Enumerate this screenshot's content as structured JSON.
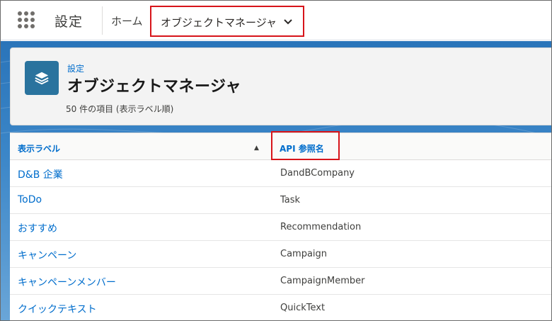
{
  "nav": {
    "app_name": "設定",
    "home": "ホーム",
    "active_tab": "オブジェクトマネージャ"
  },
  "header": {
    "breadcrumb": "設定",
    "title": "オブジェクトマネージャ",
    "count": "50 件の項目 (表示ラベル順)"
  },
  "table": {
    "columns": [
      "表示ラベル",
      "API 参照名"
    ],
    "sort_indicator": "▲",
    "rows": [
      {
        "label": "D&B 企業",
        "api": "DandBCompany"
      },
      {
        "label": "ToDo",
        "api": "Task"
      },
      {
        "label": "おすすめ",
        "api": "Recommendation"
      },
      {
        "label": "キャンペーン",
        "api": "Campaign"
      },
      {
        "label": "キャンペーンメンバー",
        "api": "CampaignMember"
      },
      {
        "label": "クイックテキスト",
        "api": "QuickText"
      }
    ]
  },
  "colors": {
    "link": "#006dcc",
    "highlight": "#d7141a",
    "brand_blue": "#2a74b9",
    "icon_bg": "#2a739e"
  },
  "icons": {
    "launcher": "app-launcher-grid-icon",
    "tab_menu": "chevron-down-icon",
    "object": "layers-icon",
    "sort": "sort-ascending-icon"
  }
}
